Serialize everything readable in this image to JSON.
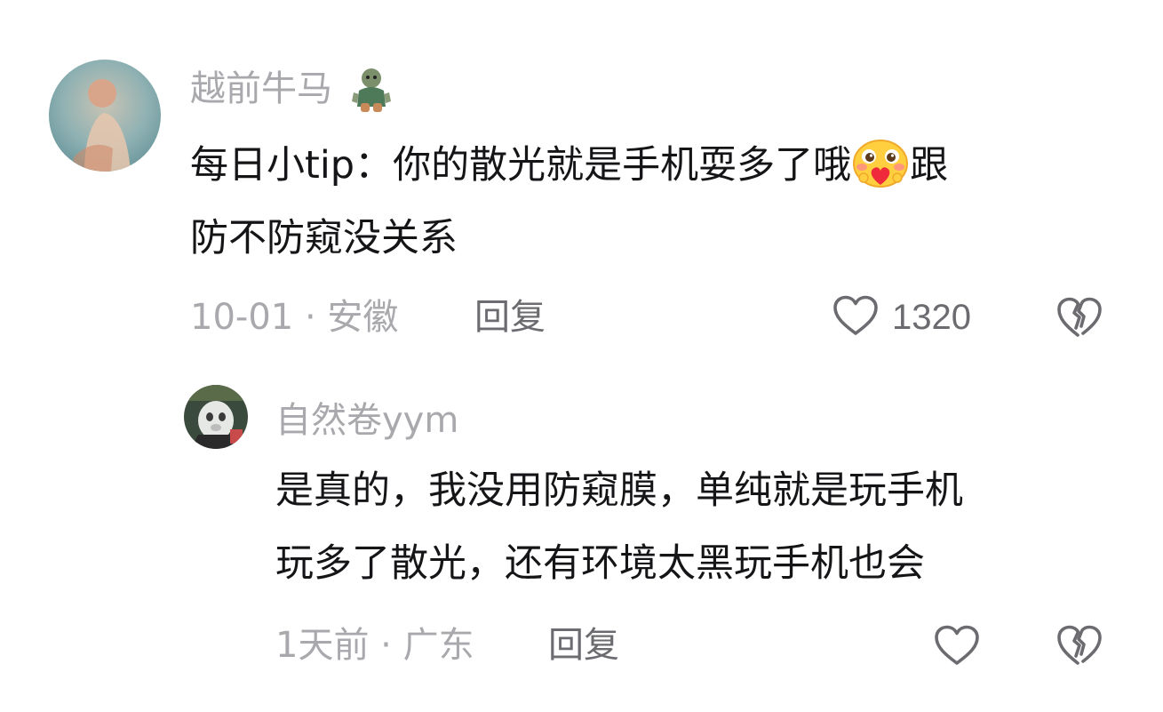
{
  "comments": [
    {
      "username": "越前牛马",
      "badge_icon": "character-badge-icon",
      "text_line_1": "每日小tip：你的散光就是手机耍多了哦",
      "text_emoji": "shy-heart-emoji",
      "text_line_1_end": "跟",
      "text_line_2": "防不防窥没关系",
      "date_location": "10-01 · 安徽",
      "reply_label": "回复",
      "like_count": "1320",
      "like_icon": "heart-outline-icon",
      "dislike_icon": "broken-heart-icon"
    },
    {
      "username": "自然卷yym",
      "text_line_1": "是真的，我没用防窥膜，单纯就是玩手机",
      "text_line_2": "玩多了散光，还有环境太黑玩手机也会",
      "date_location": "1天前 · 广东",
      "reply_label": "回复",
      "like_icon": "heart-outline-icon",
      "dislike_icon": "broken-heart-icon"
    }
  ],
  "colors": {
    "username": "#a9a9ad",
    "body_text": "#151518",
    "action_text": "#6b6b70",
    "background": "#ffffff"
  }
}
